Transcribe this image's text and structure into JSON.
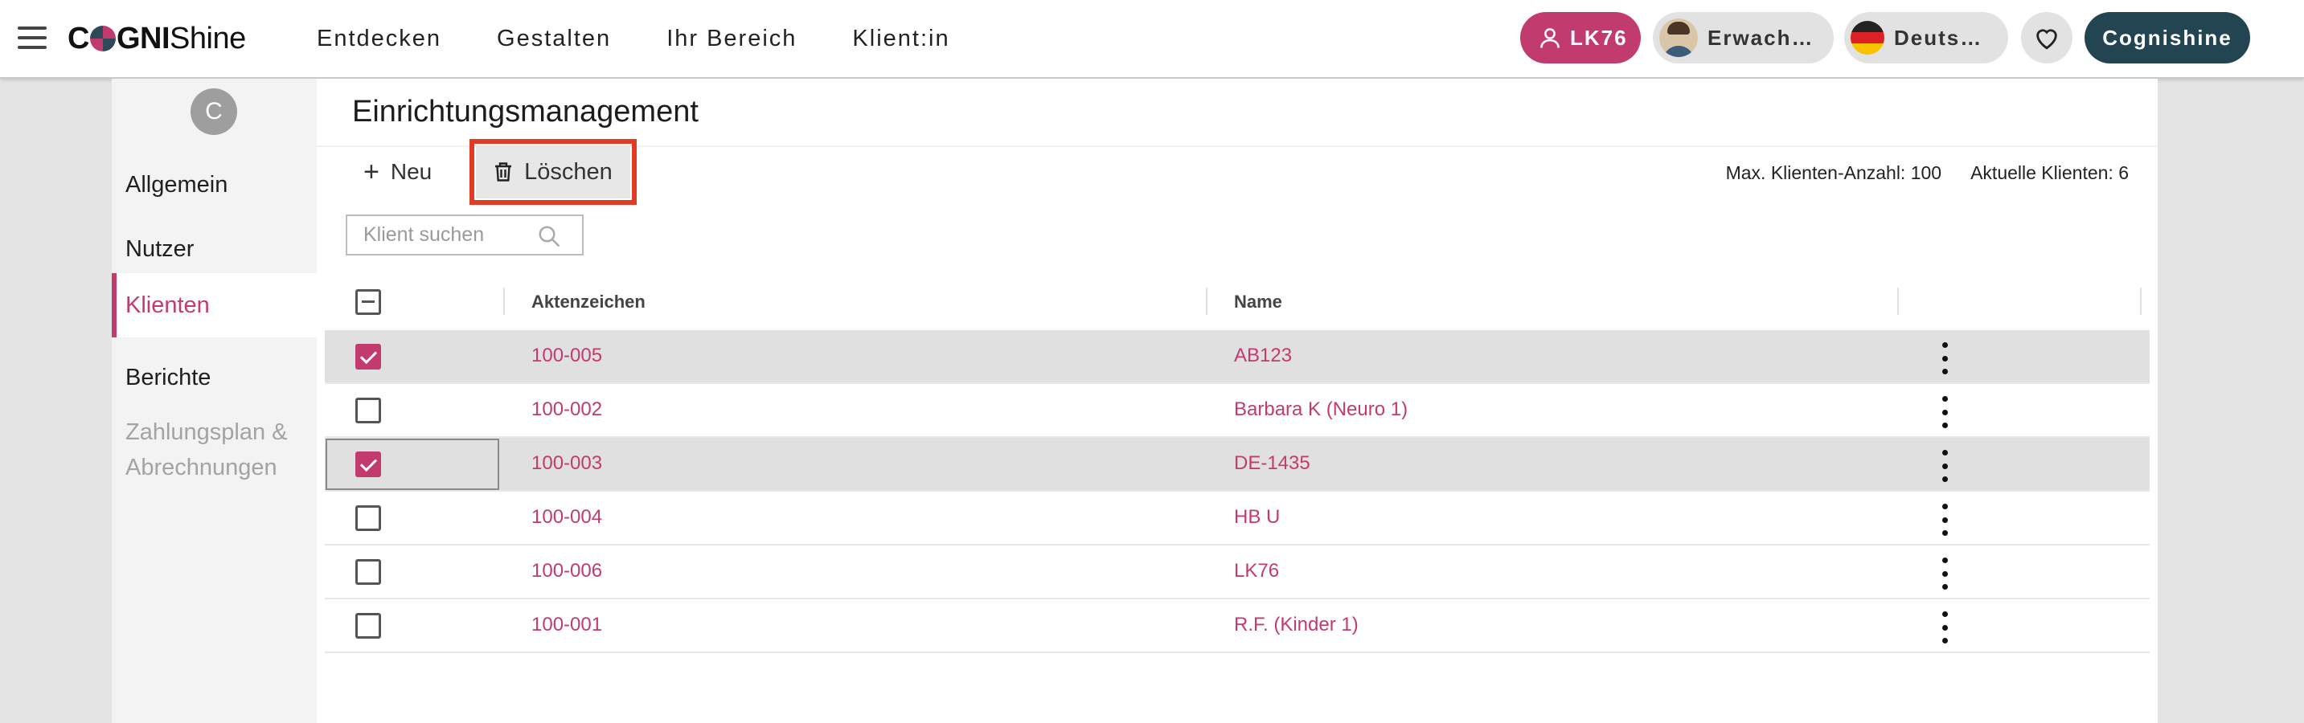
{
  "header": {
    "logo_bold": "C",
    "logo_bold2": "GNI",
    "logo_light": "Shine",
    "nav": [
      "Entdecken",
      "Gestalten",
      "Ihr Bereich",
      "Klient:in"
    ],
    "user_label": "LK76",
    "age_label": "Erwach…",
    "lang_label": "Deuts…",
    "brand_label": "Cognishine",
    "icons": [
      "menu-icon",
      "user-icon",
      "avatar-icon",
      "german-flag-icon",
      "heart-icon"
    ],
    "colors": {
      "accent": "#c23b6f",
      "brand": "#234451"
    }
  },
  "sidebar": {
    "avatar_letter": "C",
    "items": [
      {
        "label": "Allgemein"
      },
      {
        "label": "Nutzer"
      },
      {
        "label": "Klienten"
      },
      {
        "label": "Berichte"
      },
      {
        "label": "Zahlungsplan &",
        "label2": "Abrechnungen"
      }
    ],
    "active_item": "Klienten"
  },
  "main": {
    "title": "Einrichtungsmanagement",
    "new_label": "Neu",
    "delete_label": "Löschen",
    "max_clients": "Max. Klienten-Anzahl: 100",
    "current_clients": "Aktuelle Klienten: 6",
    "search_placeholder": "Klient suchen"
  },
  "table": {
    "columns": [
      "Aktenzeichen",
      "Name"
    ],
    "rows": [
      {
        "ref": "100-005",
        "name": "AB123",
        "checked": true
      },
      {
        "ref": "100-002",
        "name": "Barbara K (Neuro 1)",
        "checked": false
      },
      {
        "ref": "100-003",
        "name": "DE-1435",
        "checked": true
      },
      {
        "ref": "100-004",
        "name": "HB U",
        "checked": false
      },
      {
        "ref": "100-006",
        "name": "LK76",
        "checked": false
      },
      {
        "ref": "100-001",
        "name": "R.F. (Kinder 1)",
        "checked": false
      }
    ]
  }
}
